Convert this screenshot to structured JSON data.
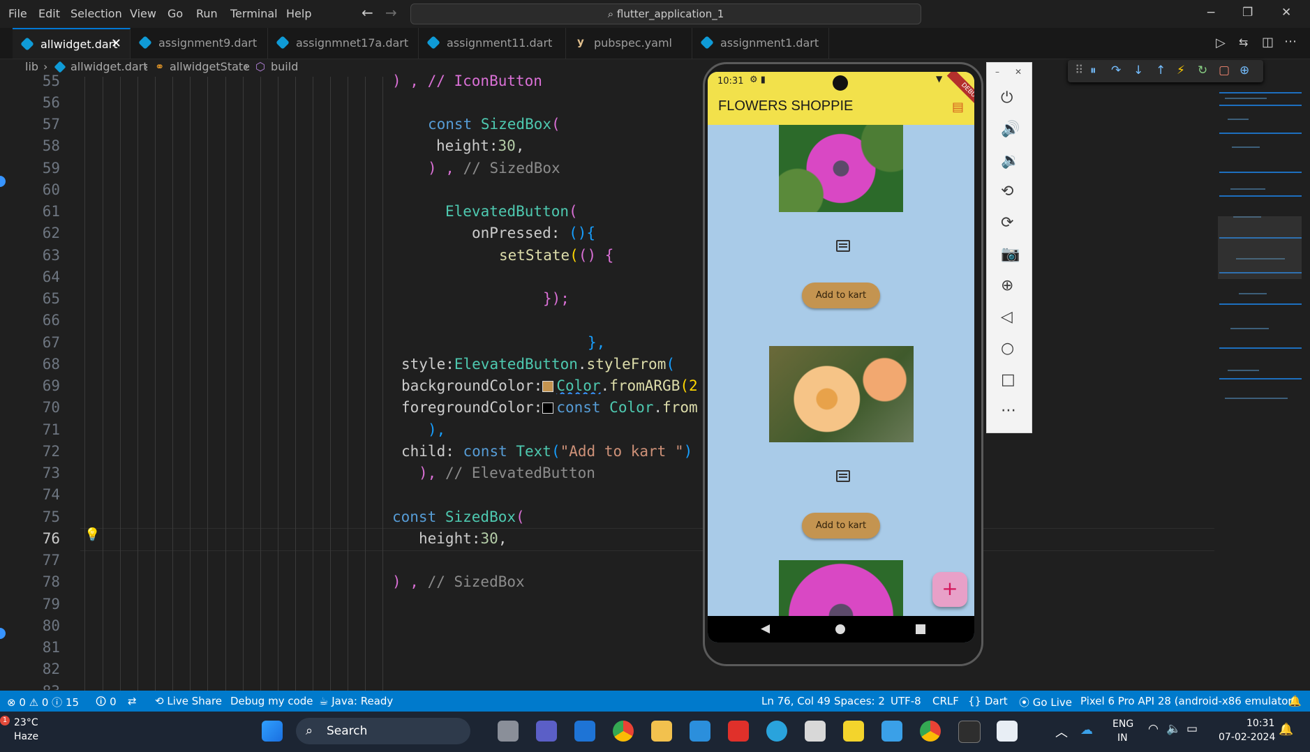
{
  "menu": [
    "File",
    "Edit",
    "Selection",
    "View",
    "Go",
    "Run",
    "Terminal",
    "Help"
  ],
  "command_center": "flutter_application_1",
  "window_controls": {
    "minimize": "−",
    "maximize": "❐",
    "close": "✕"
  },
  "tabs": [
    {
      "label": "allwidget.dart",
      "active": true
    },
    {
      "label": "assignment9.dart"
    },
    {
      "label": "assignmnet17a.dart"
    },
    {
      "label": "assignment11.dart"
    },
    {
      "label": "pubspec.yaml"
    },
    {
      "label": "assignment1.dart"
    }
  ],
  "breadcrumb": {
    "lib": "lib",
    "file": "allwidget.dart",
    "class": "allwidgetState",
    "method": "build"
  },
  "line_numbers": [
    "55",
    "56",
    "57",
    "58",
    "59",
    "60",
    "61",
    "62",
    "63",
    "64",
    "65",
    "66",
    "67",
    "68",
    "69",
    "70",
    "71",
    "72",
    "73",
    "74",
    "75",
    "76",
    "77",
    "78",
    "79",
    "80",
    "81",
    "82",
    "83"
  ],
  "code": {
    "l55": ") , // IconButton",
    "l57a": "const ",
    "l57b": "SizedBox",
    "l57c": "(",
    "l58a": "height",
    "l58b": ":",
    "l58c": "30",
    "l58d": ",",
    "l59a": ") , ",
    "l59b": "// SizedBox",
    "l61a": "ElevatedButton",
    "l61b": "(",
    "l62a": "onPressed",
    "l62b": ": ",
    "l62c": "(){",
    "l63a": "setState",
    "l63b": "(",
    "l63c": "() {",
    "l65a": "});",
    "l67a": "},",
    "l68a": "style",
    "l68b": ":",
    "l68c": "ElevatedButton",
    "l68d": ".",
    "l68e": "styleFrom",
    "l68f": "(",
    "l69a": "backgroundColor",
    "l69b": ":",
    "l69c": "Color",
    "l69d": ".",
    "l69e": "fromARGB",
    "l69f": "(2",
    "l70a": "foregroundColor",
    "l70b": ":",
    "l70c": "const ",
    "l70d": "Color",
    "l70e": ".",
    "l70f": "from",
    "l71a": "),",
    "l72a": "child",
    "l72b": ": ",
    "l72c": "const ",
    "l72d": "Text",
    "l72e": "(",
    "l72f": "\"Add to kart \"",
    "l72g": ")",
    "l73a": "), ",
    "l73b": "// ElevatedButton",
    "l75a": "const ",
    "l75b": "SizedBox",
    "l75c": "(",
    "l76a": "height",
    "l76b": ":",
    "l76c": "30",
    "l76d": ",",
    "l78a": ") , ",
    "l78b": "// SizedBox"
  },
  "phone": {
    "time": "10:31",
    "debug_banner": "DEBUG",
    "app_title": "FLOWERS SHOPPIE",
    "kart_button_1": "Add to kart",
    "kart_button_2": "Add to kart",
    "fab_label": "+",
    "appbar_color": "#f2e14b",
    "background_color": "#a9cbe8",
    "button_color": "#c49450",
    "fab_color": "#e8a0c8"
  },
  "emulator_panel": {
    "buttons": [
      "power-icon",
      "volume-up-icon",
      "volume-down-icon",
      "rotate-left-icon",
      "rotate-right-icon",
      "camera-icon",
      "zoom-icon",
      "back-icon",
      "home-icon",
      "overview-icon",
      "more-icon"
    ]
  },
  "status": {
    "errors": "⊗ 0 ⚠ 0 ⓘ 15",
    "ports": "🛈 0",
    "live_share": "Live Share",
    "debug": "Debug my code",
    "java": "Java: Ready",
    "position": "Ln 76, Col 49",
    "spaces": "Spaces: 2",
    "encoding": "UTF-8",
    "eol": "CRLF",
    "language": "{} Dart",
    "go_live": "Go Live",
    "device": "Pixel 6 Pro API 28 (android-x86 emulator)"
  },
  "taskbar": {
    "weather_temp": "23°C",
    "weather_desc": "Haze",
    "search": "Search",
    "lang_top": "ENG",
    "lang_bottom": "IN",
    "time": "10:31",
    "date": "07-02-2024"
  }
}
